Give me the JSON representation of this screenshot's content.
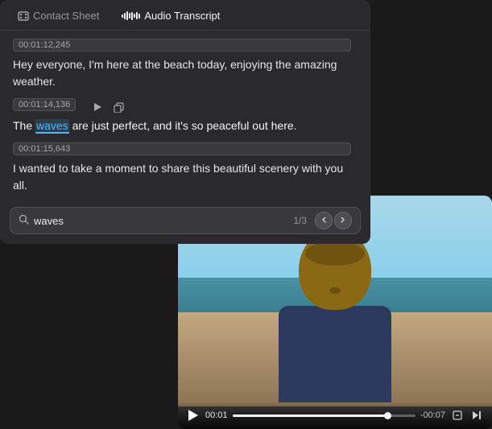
{
  "tabs": [
    {
      "id": "contact-sheet",
      "label": "Contact Sheet",
      "icon": "film-icon",
      "active": false
    },
    {
      "id": "audio-transcript",
      "label": "Audio Transcript",
      "icon": "waveform-icon",
      "active": true
    }
  ],
  "transcript": {
    "entries": [
      {
        "id": "entry-1",
        "timestamp": "00:01:12,245",
        "text": "Hey everyone, I'm here at the beach today, enjoying the amazing weather.",
        "highlight": null,
        "active": false
      },
      {
        "id": "entry-2",
        "timestamp": "00:01:14,136",
        "text_before": "The ",
        "text_highlight": "waves",
        "text_after": " are just perfect, and it's so peaceful out here.",
        "highlight": "waves",
        "active": true
      },
      {
        "id": "entry-3",
        "timestamp": "00:01:15,643",
        "text": "I wanted to take a moment to share this beautiful scenery with you all.",
        "highlight": null,
        "active": false
      }
    ]
  },
  "search": {
    "value": "waves",
    "placeholder": "Search",
    "count": "1/3"
  },
  "video": {
    "current_time": "00:01",
    "remaining_time": "-00:07",
    "progress_percent": 85
  }
}
